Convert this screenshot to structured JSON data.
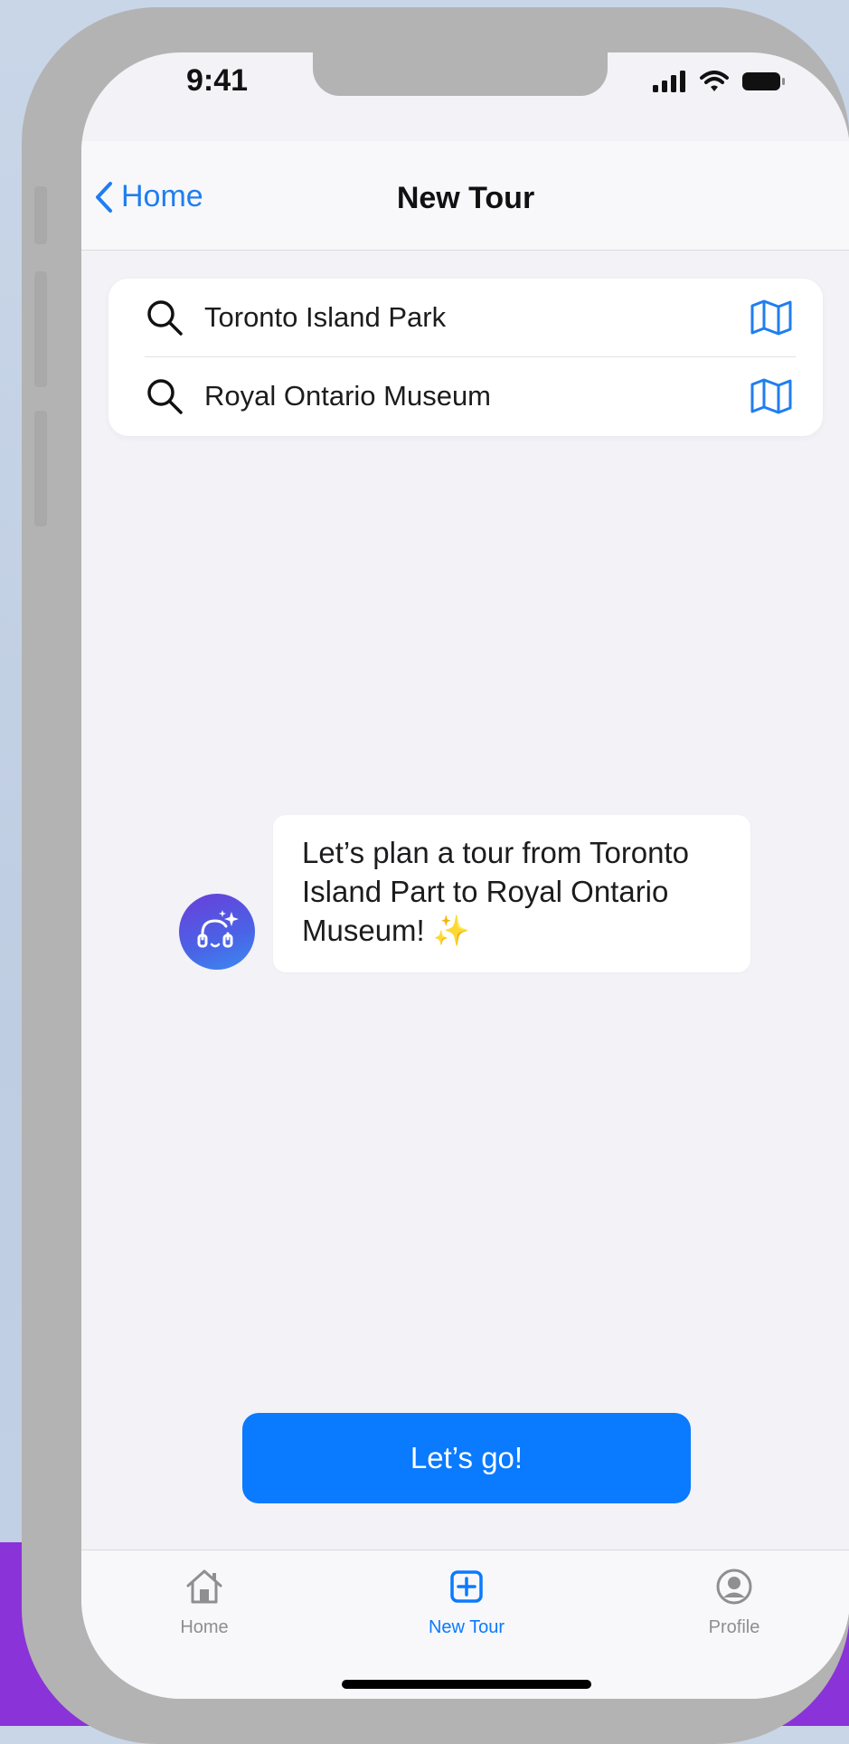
{
  "status_bar": {
    "time": "9:41"
  },
  "nav": {
    "back_label": "Home",
    "title": "New Tour"
  },
  "search": {
    "rows": [
      {
        "text": "Toronto Island Park"
      },
      {
        "text": "Royal Ontario Museum"
      }
    ]
  },
  "chat": {
    "message": "Let’s plan a tour from Toronto Island Part to Royal Ontario Museum!",
    "emoji": "✨"
  },
  "cta": {
    "label": "Let’s go!"
  },
  "tabs": [
    {
      "label": "Home",
      "icon": "house-icon",
      "active": false
    },
    {
      "label": "New Tour",
      "icon": "plus-square-icon",
      "active": true
    },
    {
      "label": "Profile",
      "icon": "person-circle-icon",
      "active": false
    }
  ],
  "colors": {
    "accent": "#0a7aff",
    "link": "#1f7ef0",
    "tab_inactive": "#8e8e93",
    "outer_band": "#8a33d8",
    "frame": "#b3b3b3"
  }
}
